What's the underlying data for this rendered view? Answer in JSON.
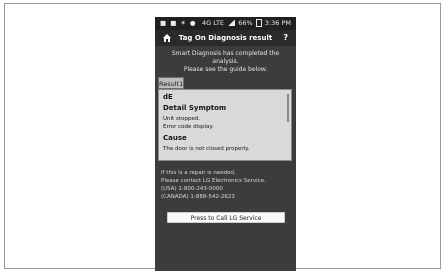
{
  "status_bar": {
    "left_icons": "■ ■ ✶ ●",
    "network": "4G LTE",
    "battery": "66%",
    "time": "3:36 PM"
  },
  "header": {
    "title": "Tag On Diagnosis result",
    "help": "?"
  },
  "intro": {
    "line1": "Smart Diagnosis has completed the analysis.",
    "line2": "Please see the guide below."
  },
  "tab": {
    "label": "Result1"
  },
  "result": {
    "code": "dE",
    "detail_heading": "Detail Symptom",
    "detail_line1": "Unit stopped.",
    "detail_line2": "Error code display.",
    "cause_heading": "Cause",
    "cause_line1": "The door is not closed properly."
  },
  "contact": {
    "line1": "If this is a repair is needed,",
    "line2": "Please contact LG Electronics Service.",
    "usa": "(USA) 1-800-243-0000",
    "canada": "(CANADA) 1-888-542-2623"
  },
  "call_button": {
    "label": "Press to Call LG Service"
  },
  "colors": {
    "phone_bg": "#3c3c3c",
    "panel_bg": "#d9d9d9"
  }
}
